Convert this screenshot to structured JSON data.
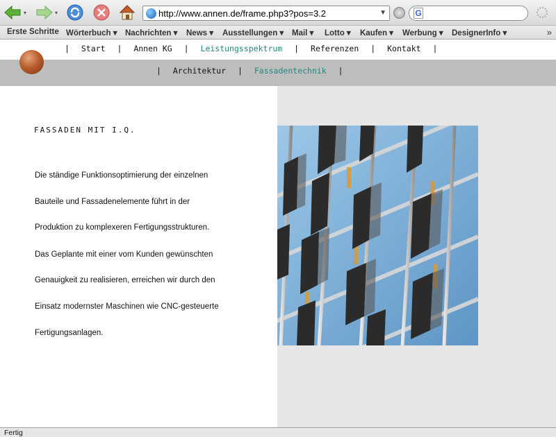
{
  "browser": {
    "url": "http://www.annen.de/frame.php3?pos=3.2",
    "status": "Fertig",
    "search_value": ""
  },
  "bookmarks": [
    {
      "label": "Erste Schritte"
    },
    {
      "label": "Wörterbuch ▾"
    },
    {
      "label": "Nachrichten ▾"
    },
    {
      "label": "News ▾"
    },
    {
      "label": "Ausstellungen ▾"
    },
    {
      "label": "Mail ▾"
    },
    {
      "label": "Lotto ▾"
    },
    {
      "label": "Kaufen ▾"
    },
    {
      "label": "Werbung ▾"
    },
    {
      "label": "DesignerInfo ▾"
    }
  ],
  "bookmarks_more": "»",
  "nav_main": [
    {
      "label": "Start"
    },
    {
      "label": "Annen KG"
    },
    {
      "label": "Leistungsspektrum"
    },
    {
      "label": "Referenzen"
    },
    {
      "label": "Kontakt"
    }
  ],
  "nav_sub": [
    {
      "label": "Architektur"
    },
    {
      "label": "Fassadentechnik"
    }
  ],
  "separator": "|",
  "content": {
    "heading": "FASSADEN MIT I.Q.",
    "lines": [
      "Die ständige Funktionsoptimierung der einzelnen",
      "Bauteile und Fassadenelemente führt in der",
      "Produktion zu komplexeren Fertigungsstrukturen.",
      "Das Geplante mit einer vom Kunden gewünschten",
      "Genauigkeit zu realisieren, erreichen wir durch den",
      "Einsatz modernster Maschinen wie CNC-gesteuerte",
      "Fertigungsanlagen."
    ]
  },
  "colors": {
    "accent": "#1f8a80",
    "subnav_bg": "#bdbdbd",
    "panel_bg": "#e6e6e6"
  }
}
